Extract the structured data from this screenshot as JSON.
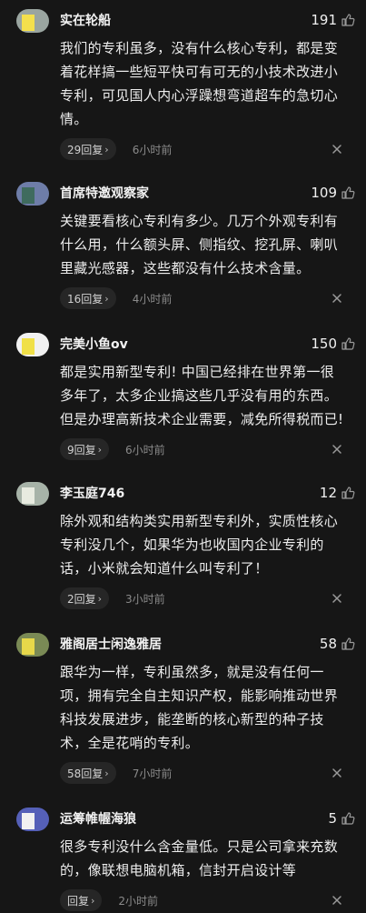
{
  "comments": [
    {
      "username": "实在轮船",
      "likes": "191",
      "text": "我们的专利虽多，没有什么核心专利，都是变着花样搞一些短平快可有可无的小技术改进小专利，可见国人内心浮躁想弯道超车的急切心情。",
      "reply_label": "29回复",
      "time": "6小时前",
      "avatar_colors": [
        "#9aa5a0",
        "#f4e04d"
      ]
    },
    {
      "username": "首席特邀观察家",
      "likes": "109",
      "text": "关键要看核心专利有多少。几万个外观专利有什么用，什么额头屏、侧指纹、挖孔屏、喇叭里藏光感器，这些都没有什么技术含量。",
      "reply_label": "16回复",
      "time": "4小时前",
      "avatar_colors": [
        "#6e7da8",
        "#3f6b5e"
      ]
    },
    {
      "username": "完美小鱼ov",
      "likes": "150",
      "text": "都是实用新型专利! 中国已经排在世界第一很多年了，太多企业搞这些几乎没有用的东西。但是办理高新技术企业需要，减免所得税而已!",
      "reply_label": "9回复",
      "time": "6小时前",
      "avatar_colors": [
        "#f1f1f1",
        "#f0e048"
      ]
    },
    {
      "username": "李玉庭746",
      "likes": "12",
      "text": "除外观和结构类实用新型专利外，实质性核心专利没几个，如果华为也收国内企业专利的话，小米就会知道什么叫专利了！",
      "reply_label": "2回复",
      "time": "3小时前",
      "avatar_colors": [
        "#a7b3a8",
        "#e8ebe0"
      ]
    },
    {
      "username": "雅阁居士闲逸雅居",
      "likes": "58",
      "text": "跟华为一样，专利虽然多，就是没有任何一项，拥有完全自主知识产权，能影响推动世界科技发展进步，能垄断的核心新型的种子技术，全是花哨的专利。",
      "reply_label": "58回复",
      "time": "7小时前",
      "avatar_colors": [
        "#7a8a55",
        "#e7d84a"
      ]
    },
    {
      "username": "运筹帷幄海狼",
      "likes": "5",
      "text": "很多专利没什么含金量低。只是公司拿来充数的，像联想电脑机箱，信封开启设计等",
      "reply_label": "回复",
      "time": "2小时前",
      "avatar_colors": [
        "#5560b8",
        "#f1f1f1"
      ]
    }
  ],
  "icons": {
    "like": "thumbs-up-icon",
    "reply_chevron": "chevron-right-icon",
    "close": "close-icon"
  }
}
